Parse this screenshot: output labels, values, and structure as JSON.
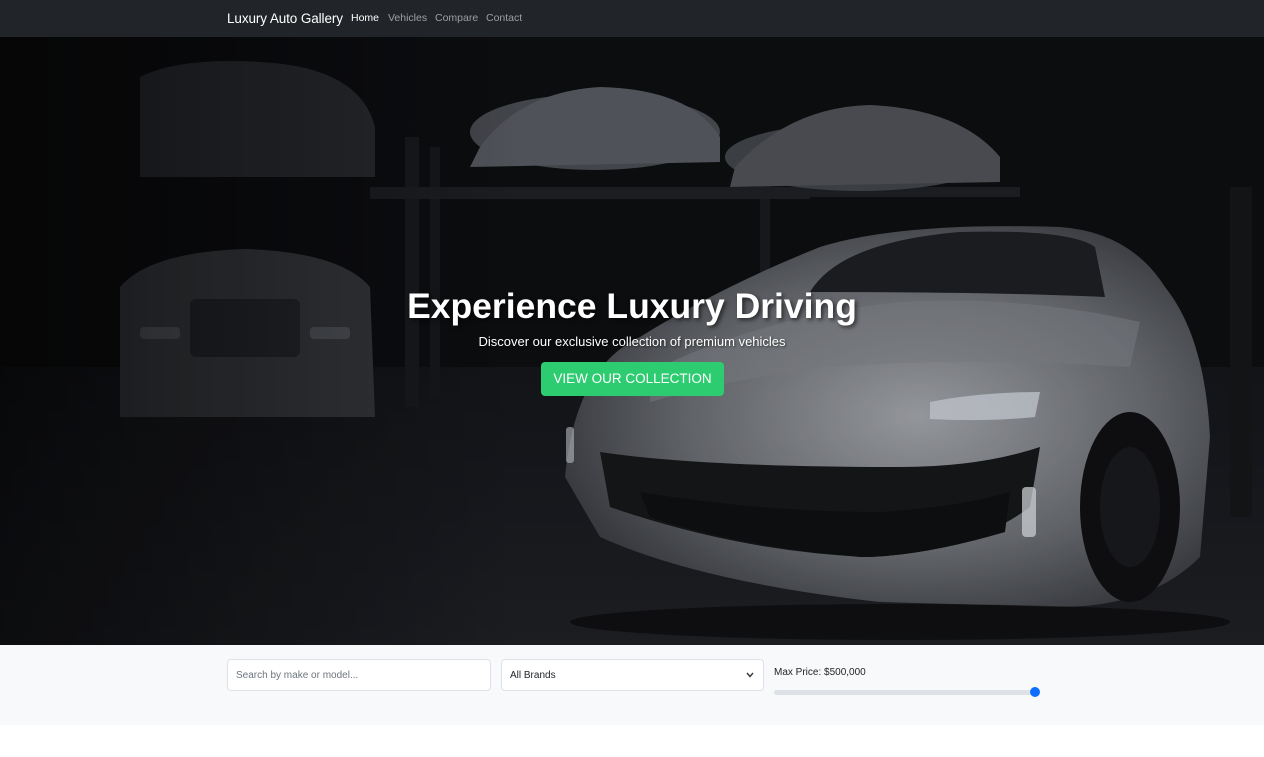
{
  "navbar": {
    "brand": "Luxury Auto Gallery",
    "links": [
      {
        "label": "Home",
        "active": true
      },
      {
        "label": "Vehicles",
        "active": false
      },
      {
        "label": "Compare",
        "active": false
      },
      {
        "label": "Contact",
        "active": false
      }
    ]
  },
  "hero": {
    "title": "Experience Luxury Driving",
    "subtitle": "Discover our exclusive collection of premium vehicles",
    "cta_label": "VIEW OUR COLLECTION",
    "cta_color": "#2ecc71"
  },
  "filters": {
    "search": {
      "placeholder": "Search by make or model...",
      "value": ""
    },
    "brand_select": {
      "selected": "All Brands",
      "icon": "chevron-down-icon"
    },
    "price": {
      "label": "Max Price: $500,000",
      "value_fraction": 1.0,
      "accent_color": "#0d6efd"
    }
  }
}
